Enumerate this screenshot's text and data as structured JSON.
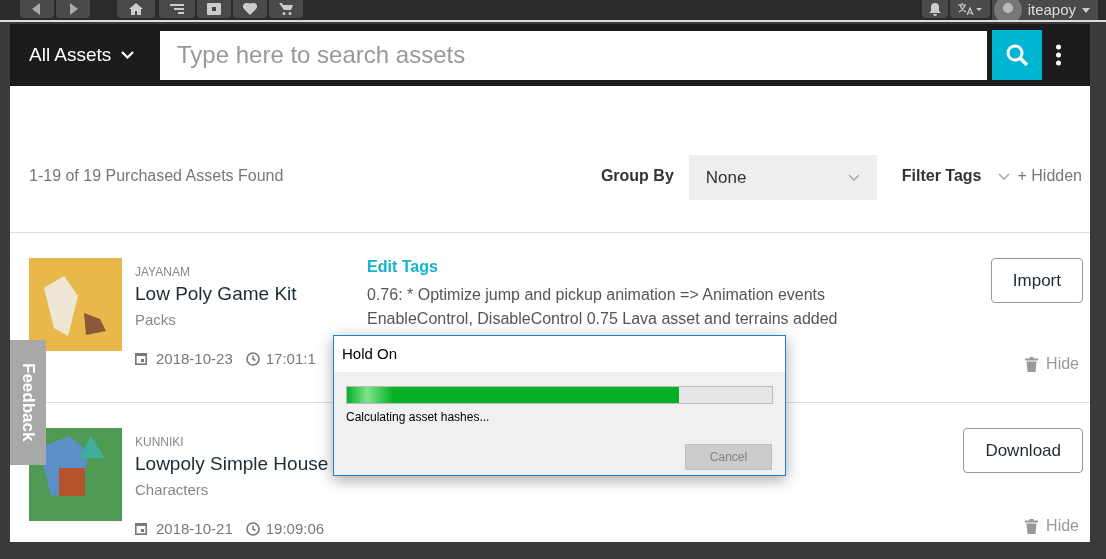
{
  "top_bar": {
    "username": "iteapoy"
  },
  "search_bar": {
    "scope": "All Assets",
    "placeholder": "Type here to search assets"
  },
  "results": {
    "count": "1-19 of 19 Purchased Assets Found",
    "group_by_label": "Group By",
    "group_by_value": "None",
    "filter_tags_label": "Filter Tags",
    "hidden_label": "+ Hidden"
  },
  "assets": [
    {
      "publisher": "JAYANAM",
      "title": "Low Poly Game Kit",
      "category": "Packs",
      "date": "2018-10-23",
      "time": "17:01:1",
      "edit_tags": "Edit Tags",
      "notes": "0.76: * Optimize jump and pickup animation => Animation events EnableControl, DisableControl 0.75 Lava asset and terrains added",
      "action": "Import",
      "hide": "Hide"
    },
    {
      "publisher": "KUNNIKI",
      "title": "Lowpoly Simple House",
      "category": "Characters",
      "date": "2018-10-21",
      "time": "19:09:06",
      "action": "Download",
      "hide": "Hide"
    }
  ],
  "feedback": "Feedback",
  "dialog": {
    "title": "Hold On",
    "level": 0.78,
    "message": "Calculating asset hashes...",
    "button": {
      "label": "Cancel",
      "disabled": true
    }
  }
}
